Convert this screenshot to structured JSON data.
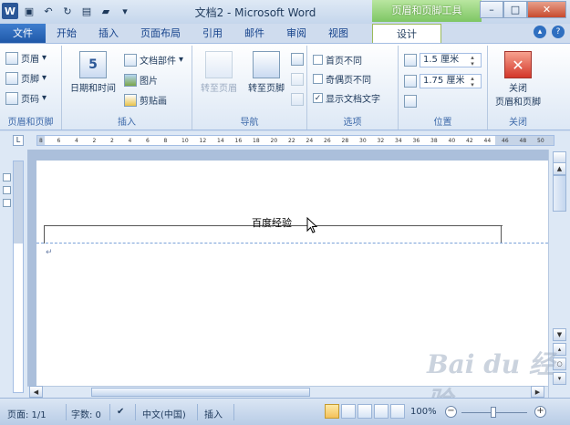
{
  "window": {
    "title": "文档2 - Microsoft Word",
    "contextual_tab_group": "页眉和页脚工具",
    "minimize": "–",
    "maximize": "□",
    "close": "✕"
  },
  "tabs": [
    {
      "label": "文件"
    },
    {
      "label": "开始"
    },
    {
      "label": "插入"
    },
    {
      "label": "页面布局"
    },
    {
      "label": "引用"
    },
    {
      "label": "邮件"
    },
    {
      "label": "审阅"
    },
    {
      "label": "视图"
    },
    {
      "label": "设计"
    }
  ],
  "ribbon": {
    "group_header_footer": {
      "label": "页眉和页脚",
      "header": "页眉",
      "footer": "页脚",
      "page_number": "页码"
    },
    "group_insert": {
      "label": "插入",
      "date_time": "日期和时间",
      "date_icon_glyph": "5",
      "doc_parts": "文档部件",
      "picture": "图片",
      "clip_art": "剪贴画"
    },
    "group_navigation": {
      "label": "导航",
      "go_to_header": "转至页眉",
      "go_to_footer": "转至页脚"
    },
    "group_options": {
      "label": "选项",
      "different_first_page": "首页不同",
      "different_odd_even": "奇偶页不同",
      "show_document_text": "显示文档文字",
      "show_document_text_checked": true,
      "check_glyph": "✓"
    },
    "group_position": {
      "label": "位置",
      "header_from_top": "1.5 厘米",
      "footer_from_bottom": "1.75 厘米"
    },
    "group_close": {
      "label": "关闭",
      "close_button_line1": "关闭",
      "close_button_line2": "页眉和页脚",
      "close_glyph": "✕"
    }
  },
  "ruler": {
    "corner_glyph": "L",
    "numbers": [
      "8",
      "6",
      "4",
      "2",
      "2",
      "4",
      "6",
      "8",
      "10",
      "12",
      "14",
      "16",
      "18",
      "20",
      "22",
      "24",
      "26",
      "28",
      "30",
      "32",
      "34",
      "36",
      "38",
      "40",
      "42",
      "44",
      "46",
      "48",
      "50"
    ]
  },
  "document": {
    "header_text": "百度经验",
    "paragraph_mark": "↵"
  },
  "scrollbar": {
    "up": "▲",
    "down": "▼",
    "prev_page": "▴",
    "browse_object": "○",
    "next_page": "▾",
    "left": "◀",
    "right": "▶"
  },
  "status": {
    "page": "页面: 1/1",
    "words": "字数: 0",
    "language": "中文(中国)",
    "mode": "插入",
    "zoom": "100%",
    "zoom_out": "−",
    "zoom_in": "+"
  },
  "watermark": "Bai du 经验",
  "colors": {
    "accent": "#2b5797",
    "contextual": "#7ec664",
    "close_red": "#d3372a"
  }
}
